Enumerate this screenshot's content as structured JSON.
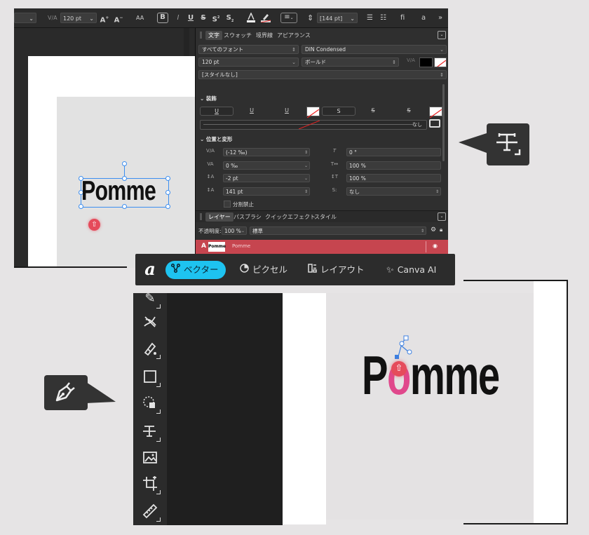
{
  "toolbar": {
    "font_size": "120 pt",
    "bold": "B",
    "italic": "I",
    "underline": "U",
    "strike": "S",
    "superscript": "S",
    "subscript": "S",
    "case": "AA",
    "grow": "A",
    "shrink": "A",
    "line_height": "[144 pt]",
    "ligature": "fi",
    "glyph": "a",
    "more": "»"
  },
  "panel": {
    "tabs": [
      "文字",
      "スウォッチ",
      "境界線",
      "アピアランス"
    ],
    "font_collection": "すべてのフォント",
    "font_family": "DIN Condensed",
    "size": "120 pt",
    "weight": "ボールド",
    "style": "[スタイルなし]",
    "decoration": {
      "heading": "装飾",
      "underline_buttons": [
        "U",
        "U",
        "U"
      ],
      "strike_buttons": [
        "S",
        "S",
        "S"
      ],
      "none_label": "なし"
    },
    "transform": {
      "heading": "位置と変形",
      "tracking": "(-12 ‰)",
      "kerning": "0 ‰",
      "baseline": "-2 pt",
      "leading": "141 pt",
      "skew": "0 °",
      "horizontal_scale": "100 %",
      "vertical_scale": "100 %",
      "shear": "なし",
      "no_break": "分割禁止"
    },
    "layers_tabs": [
      "レイヤー",
      "パスブラシ",
      "クイックエフェクト",
      "スタイル"
    ],
    "opacity_label": "不透明度:",
    "opacity": "100 %",
    "blend": "標準",
    "layer_name": "Pomme"
  },
  "canvas": {
    "small_text": "Pomme",
    "big_text_p": "P",
    "big_text_o": "o",
    "big_text_rest": "mme"
  },
  "mode_bar": {
    "modes": [
      {
        "label": "ベクター",
        "active": true
      },
      {
        "label": "ピクセル",
        "active": false
      },
      {
        "label": "レイアウト",
        "active": false
      },
      {
        "label": "Canva AI",
        "active": false
      }
    ]
  },
  "colors": {
    "accent": "#1ec3f0",
    "layer_highlight": "#c6454f",
    "warning": "#e54b5b",
    "pink_glyph": "#e0488c"
  },
  "tools": [
    "pencil-icon",
    "paint-brush-icon",
    "fill-icon",
    "rectangle-icon",
    "selection-icon",
    "text-tool-icon",
    "image-icon",
    "crop-icon",
    "ruler-icon"
  ]
}
